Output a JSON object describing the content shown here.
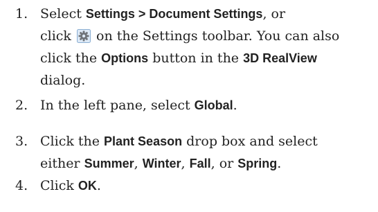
{
  "steps": [
    {
      "number": "1.",
      "line1": {
        "t1": "Select ",
        "b1": "Settings > Document Settings",
        "t2": ", or"
      },
      "line2": {
        "t1": "click ",
        "icon": "document-settings-gear-icon",
        "t2": " on the Settings toolbar. You can also"
      },
      "line3": {
        "t1": "click the ",
        "b1": "Options",
        "t2": " button in the ",
        "b2": "3D RealView"
      },
      "line4": {
        "t1": "dialog."
      }
    },
    {
      "number": "2.",
      "line1": {
        "t1": "In the left pane, select ",
        "b1": "Global",
        "t2": "."
      }
    },
    {
      "number": "3.",
      "line1": {
        "t1": "Click the ",
        "b1": "Plant Season",
        "t2": " drop box and select"
      },
      "line2": {
        "t1": "either ",
        "b1": "Summer",
        "t2": ", ",
        "b2": "Winter",
        "t3": ", ",
        "b3": "Fall",
        "t4": ", or ",
        "b4": "Spring",
        "t5": "."
      }
    },
    {
      "number": "4.",
      "line1": {
        "t1": "Click ",
        "b1": "OK",
        "t2": "."
      }
    }
  ],
  "colors": {
    "text": "#222222",
    "icon_bg": "#dde9f6",
    "icon_border": "#8aaed2",
    "icon_gear": "#6f7378"
  }
}
